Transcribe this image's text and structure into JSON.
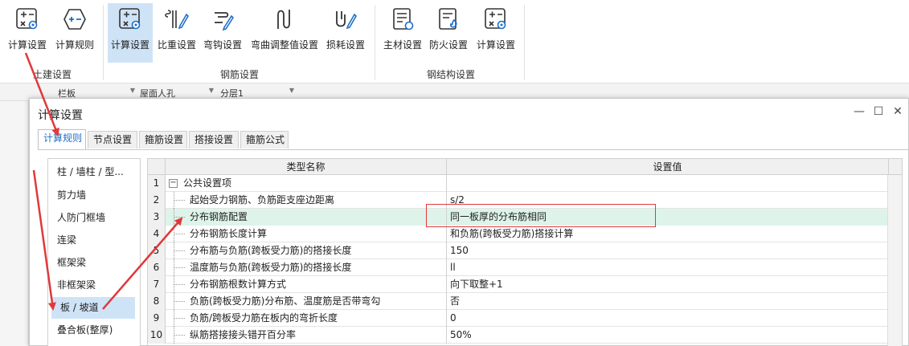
{
  "ribbon": {
    "buttons": [
      {
        "label": "计算设置",
        "icon": "calc-settings-icon",
        "active": false
      },
      {
        "label": "计算规则",
        "icon": "calc-rules-icon",
        "active": false
      },
      {
        "label": "计算设置",
        "icon": "calc-settings-icon",
        "active": true
      },
      {
        "label": "比重设置",
        "icon": "ratio-settings-icon",
        "active": false
      },
      {
        "label": "弯钩设置",
        "icon": "hook-settings-icon",
        "active": false
      },
      {
        "label": "弯曲调整值设置",
        "icon": "bend-adjust-icon",
        "active": false
      },
      {
        "label": "损耗设置",
        "icon": "loss-settings-icon",
        "active": false
      },
      {
        "label": "主材设置",
        "icon": "main-material-icon",
        "active": false
      },
      {
        "label": "防火设置",
        "icon": "fireproof-icon",
        "active": false
      },
      {
        "label": "计算设置",
        "icon": "calc-settings-icon",
        "active": false
      }
    ],
    "groups": [
      "土建设置",
      "钢筋设置",
      "钢结构设置"
    ]
  },
  "background": {
    "toolbar_cells": [
      "栏板",
      "屋面人孔",
      "分层1"
    ]
  },
  "dialog": {
    "title": "计算设置",
    "tabs": [
      "计算规则",
      "节点设置",
      "箍筋设置",
      "搭接设置",
      "箍筋公式"
    ],
    "active_tab": 0,
    "nav_items": [
      "柱 / 墙柱 / 型...",
      "剪力墙",
      "人防门框墙",
      "连梁",
      "框架梁",
      "非框架梁",
      "板 / 坡道",
      "叠合板(整厚)"
    ],
    "selected_nav": 6,
    "grid": {
      "columns": [
        "类型名称",
        "设置值"
      ],
      "rows": [
        {
          "idx": "1",
          "name": "公共设置项",
          "value": "",
          "group": true
        },
        {
          "idx": "2",
          "name": "起始受力钢筋、负筋距支座边距离",
          "value": "s/2"
        },
        {
          "idx": "3",
          "name": "分布钢筋配置",
          "value": "同一板厚的分布筋相同",
          "highlight": true
        },
        {
          "idx": "4",
          "name": "分布钢筋长度计算",
          "value": "和负筋(跨板受力筋)搭接计算"
        },
        {
          "idx": "5",
          "name": "分布筋与负筋(跨板受力筋)的搭接长度",
          "value": "150"
        },
        {
          "idx": "6",
          "name": "温度筋与负筋(跨板受力筋)的搭接长度",
          "value": "ll"
        },
        {
          "idx": "7",
          "name": "分布钢筋根数计算方式",
          "value": "向下取整+1"
        },
        {
          "idx": "8",
          "name": "负筋(跨板受力筋)分布筋、温度筋是否带弯勾",
          "value": "否"
        },
        {
          "idx": "9",
          "name": "负筋/跨板受力筋在板内的弯折长度",
          "value": "0"
        },
        {
          "idx": "10",
          "name": "纵筋搭接接头错开百分率",
          "value": "50%"
        }
      ]
    }
  },
  "colors": {
    "accent": "#1e6fc8",
    "selected_bg": "#cfe3f7",
    "highlight_row": "#def4ea",
    "annotation": "#e0393b"
  }
}
